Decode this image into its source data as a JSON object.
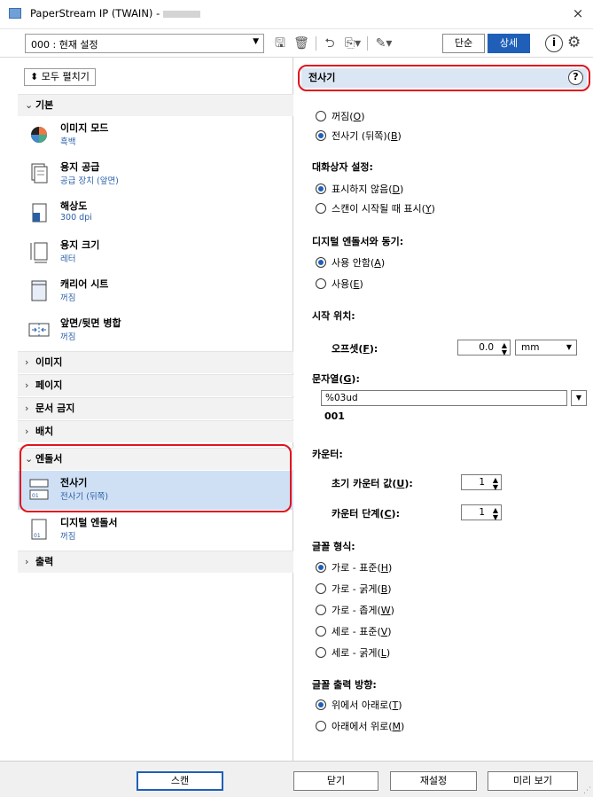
{
  "window": {
    "title": "PaperStream IP (TWAIN) -",
    "close_label": "×"
  },
  "toolbar": {
    "profile": "000 : 현재 설정",
    "mode_simple": "단순",
    "mode_detail": "상세"
  },
  "left": {
    "expand_all": "모두 펼치기",
    "groups": {
      "basic": "기본",
      "image": "이미지",
      "page": "페이지",
      "doc_protect": "문서 금지",
      "batch": "배치",
      "endorser": "엔돌서",
      "output": "출력"
    },
    "items": {
      "image_mode": {
        "label": "이미지 모드",
        "value": "흑백"
      },
      "paper_supply": {
        "label": "용지 공급",
        "value": "공급 장치 (앞면)"
      },
      "resolution": {
        "label": "해상도",
        "value": "300 dpi"
      },
      "paper_size": {
        "label": "용지 크기",
        "value": "레터"
      },
      "carrier_sheet": {
        "label": "캐리어 시트",
        "value": "꺼짐"
      },
      "merge": {
        "label": "앞면/뒷면 병합",
        "value": "꺼짐"
      },
      "imprinter": {
        "label": "전사기",
        "value": "전사기 (뒤쪽)"
      },
      "digital_endorser": {
        "label": "디지털 엔돌서",
        "value": "꺼짐"
      }
    }
  },
  "right": {
    "header": "전사기",
    "off_label": "꺼짐(",
    "off_key": "O",
    "rear_label": "전사기 (뒤쪽)(",
    "rear_key": "B",
    "dialog_title": "대화상자 설정:",
    "dialog_hide": "표시하지 않음(",
    "dialog_hide_key": "D",
    "dialog_show": "스캔이 시작될 때 표시(",
    "dialog_show_key": "Y",
    "sync_title": "디지털 엔돌서와 동기:",
    "sync_off": "사용 안함(",
    "sync_off_key": "A",
    "sync_on": "사용(",
    "sync_on_key": "E",
    "start_title": "시작 위치:",
    "offset_label": "오프셋(",
    "offset_key": "F",
    "offset_value": "0.0",
    "offset_unit": "mm",
    "string_title": "문자열(",
    "string_key": "G",
    "string_value": "%03ud",
    "string_preview": "001",
    "counter_title": "카운터:",
    "counter_init_label": "초기 카운터 값(",
    "counter_init_key": "U",
    "counter_init_value": "1",
    "counter_step_label": "카운터 단계(",
    "counter_step_key": "C",
    "counter_step_value": "1",
    "font_title": "글꼴 형식:",
    "font_h_std": "가로 - 표준(",
    "font_h_std_key": "H",
    "font_h_bold": "가로 - 굵게(",
    "font_h_bold_key": "B",
    "font_h_narrow": "가로 - 좁게(",
    "font_h_narrow_key": "W",
    "font_v_std": "세로 - 표준(",
    "font_v_std_key": "V",
    "font_v_bold": "세로 - 굵게(",
    "font_v_bold_key": "L",
    "dir_title": "글꼴 출력 방향:",
    "dir_down": "위에서 아래로(",
    "dir_down_key": "T",
    "dir_up": "아래에서 위로(",
    "dir_up_key": "M"
  },
  "bottom": {
    "scan": "스캔",
    "close": "닫기",
    "reset": "재설정",
    "preview": "미리 보기"
  },
  "colors": {
    "accent": "#1f5fb8",
    "highlight": "#e0141e",
    "selected": "#cfe0f5"
  }
}
